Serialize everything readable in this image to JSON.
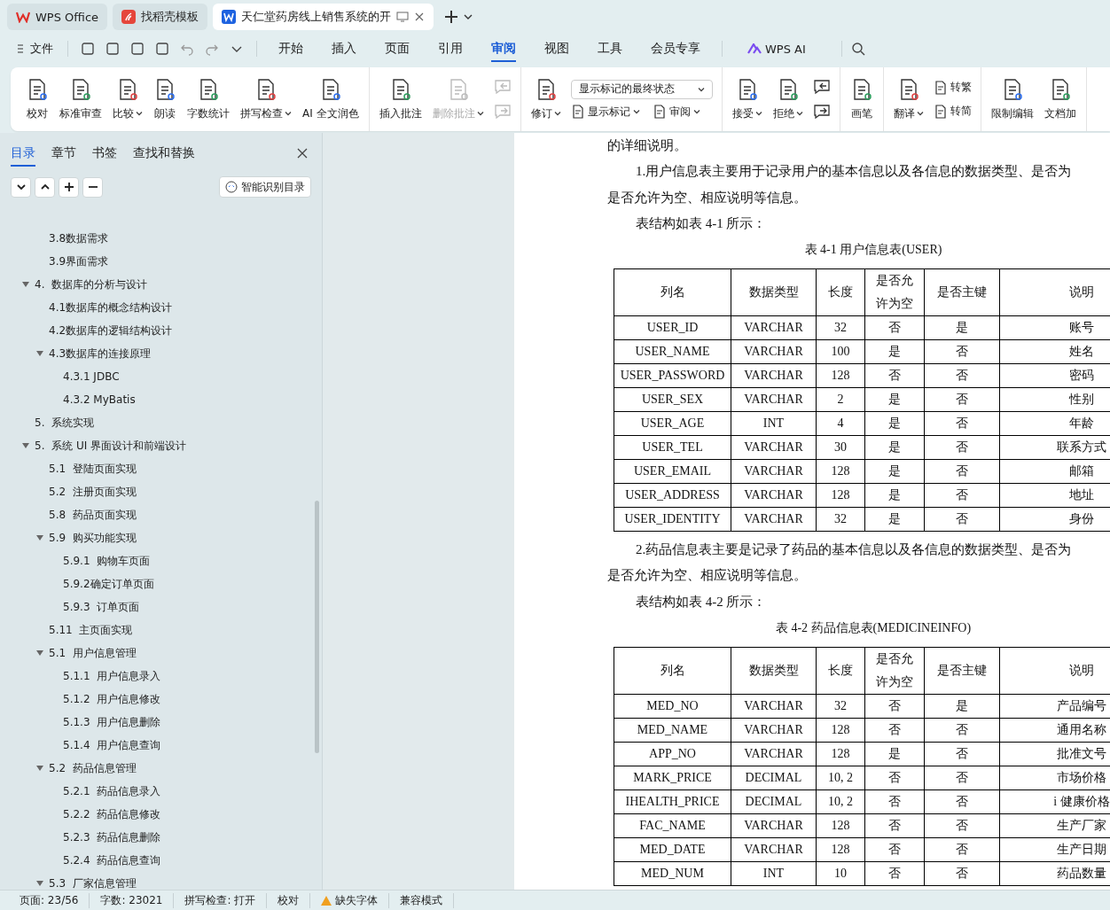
{
  "app_tabs": [
    {
      "label": "WPS Office",
      "kind": "home",
      "selected": false
    },
    {
      "label": "找稻壳模板",
      "kind": "template",
      "selected": false
    },
    {
      "label": "天仁堂药房线上销售系统的开",
      "kind": "document",
      "selected": true
    }
  ],
  "menu": {
    "file": "文件",
    "tabs": [
      {
        "label": "开始",
        "selected": false
      },
      {
        "label": "插入",
        "selected": false
      },
      {
        "label": "页面",
        "selected": false
      },
      {
        "label": "引用",
        "selected": false
      },
      {
        "label": "审阅",
        "selected": true
      },
      {
        "label": "视图",
        "selected": false
      },
      {
        "label": "工具",
        "selected": false
      },
      {
        "label": "会员专享",
        "selected": false
      }
    ],
    "ai": "WPS AI"
  },
  "ribbon": [
    [
      {
        "kind": "large",
        "label": "校对",
        "dropdown": false,
        "disabled": false
      },
      {
        "kind": "large",
        "label": "标准审查",
        "dropdown": false,
        "disabled": false
      },
      {
        "kind": "large",
        "label": "比较",
        "dropdown": true,
        "disabled": false
      },
      {
        "kind": "large",
        "label": "朗读",
        "dropdown": false,
        "disabled": false
      },
      {
        "kind": "large",
        "label": "字数统计",
        "dropdown": false,
        "disabled": false
      },
      {
        "kind": "large",
        "label": "拼写检查",
        "dropdown": true,
        "disabled": false
      },
      {
        "kind": "large",
        "label": "AI 全文润色",
        "dropdown": false,
        "disabled": false
      }
    ],
    [
      {
        "kind": "large",
        "label": "插入批注",
        "dropdown": false,
        "disabled": false
      },
      {
        "kind": "large",
        "label": "删除批注",
        "dropdown": true,
        "disabled": true
      },
      {
        "kind": "icon_pair",
        "disabled": true
      }
    ],
    [
      {
        "kind": "large",
        "label": "修订",
        "dropdown": true,
        "disabled": false
      },
      {
        "kind": "stack",
        "select": "显示标记的最终状态",
        "items": [
          {
            "label": "显示标记",
            "dropdown": true
          },
          {
            "label": "审阅",
            "dropdown": true
          }
        ]
      }
    ],
    [
      {
        "kind": "large",
        "label": "接受",
        "dropdown": true,
        "disabled": false
      },
      {
        "kind": "large",
        "label": "拒绝",
        "dropdown": true,
        "disabled": false
      },
      {
        "kind": "icon_pair",
        "disabled": false
      }
    ],
    [
      {
        "kind": "large",
        "label": "画笔",
        "dropdown": false,
        "disabled": false
      }
    ],
    [
      {
        "kind": "large",
        "label": "翻译",
        "dropdown": true,
        "disabled": false
      },
      {
        "kind": "column",
        "items": [
          {
            "label": "转繁",
            "dropdown": false
          },
          {
            "label": "转简",
            "dropdown": false
          }
        ]
      }
    ],
    [
      {
        "kind": "large",
        "label": "限制编辑",
        "dropdown": false,
        "disabled": false
      },
      {
        "kind": "large",
        "label": "文档加",
        "dropdown": false,
        "disabled": false
      }
    ]
  ],
  "left_panel": {
    "tabs": [
      {
        "label": "目录",
        "selected": true
      },
      {
        "label": "章节",
        "selected": false
      },
      {
        "label": "书签",
        "selected": false
      },
      {
        "label": "查找和替换",
        "selected": false
      }
    ],
    "smart_button": "智能识别目录",
    "toc": [
      {
        "children": [
          {
            "label": "3.8数据需求"
          },
          {
            "label": "3.9界面需求"
          }
        ]
      },
      {
        "label": "4.  数据库的分析与设计",
        "expanded": true,
        "children": [
          {
            "label": "4.1数据库的概念结构设计"
          },
          {
            "label": "4.2数据库的逻辑结构设计"
          },
          {
            "label": "4.3数据库的连接原理",
            "expanded": true,
            "children": [
              {
                "label": "4.3.1 JDBC"
              },
              {
                "label": "4.3.2 MyBatis"
              }
            ]
          }
        ]
      },
      {
        "label": "5.  系统实现"
      },
      {
        "label": "5.  系统 UI 界面设计和前端设计",
        "expanded": true,
        "children": [
          {
            "label": "5.1  登陆页面实现"
          },
          {
            "label": "5.2  注册页面实现"
          },
          {
            "label": "5.8  药品页面实现"
          },
          {
            "label": "5.9  购买功能实现",
            "expanded": true,
            "children": [
              {
                "label": "5.9.1  购物车页面"
              },
              {
                "label": "5.9.2确定订单页面"
              },
              {
                "label": "5.9.3  订单页面"
              }
            ]
          },
          {
            "label": "5.11  主页面实现"
          },
          {
            "label": "5.1  用户信息管理",
            "expanded": true,
            "children": [
              {
                "label": "5.1.1  用户信息录入"
              },
              {
                "label": "5.1.2  用户信息修改"
              },
              {
                "label": "5.1.3  用户信息删除"
              },
              {
                "label": "5.1.4  用户信息查询"
              }
            ]
          },
          {
            "label": "5.2  药品信息管理",
            "expanded": true,
            "children": [
              {
                "label": "5.2.1  药品信息录入"
              },
              {
                "label": "5.2.2  药品信息修改"
              },
              {
                "label": "5.2.3  药品信息删除"
              },
              {
                "label": "5.2.4  药品信息查询"
              }
            ]
          },
          {
            "label": "5.3  厂家信息管理",
            "expanded": true
          }
        ]
      }
    ]
  },
  "document": [
    {
      "kind": "line",
      "text": "的详细说明。"
    },
    {
      "kind": "indented_line",
      "text": "1.用户信息表主要用于记录用户的基本信息以及各信息的数据类型、是否为"
    },
    {
      "kind": "line",
      "text": "是否允许为空、相应说明等信息。"
    },
    {
      "kind": "indented_line",
      "text": "表结构如表 4-1 所示："
    },
    {
      "kind": "caption",
      "text": "表 4-1 用户信息表(USER)"
    },
    {
      "kind": "table",
      "header": [
        "列名",
        "数据类型",
        "长度",
        "是否允许为空",
        "是否主键",
        "说明"
      ],
      "rows": [
        [
          "USER_ID",
          "VARCHAR",
          "32",
          "否",
          "是",
          "账号"
        ],
        [
          "USER_NAME",
          "VARCHAR",
          "100",
          "是",
          "否",
          "姓名"
        ],
        [
          "USER_PASSWORD",
          "VARCHAR",
          "128",
          "否",
          "否",
          "密码"
        ],
        [
          "USER_SEX",
          "VARCHAR",
          "2",
          "是",
          "否",
          "性别"
        ],
        [
          "USER_AGE",
          "INT",
          "4",
          "是",
          "否",
          "年龄"
        ],
        [
          "USER_TEL",
          "VARCHAR",
          "30",
          "是",
          "否",
          "联系方式"
        ],
        [
          "USER_EMAIL",
          "VARCHAR",
          "128",
          "是",
          "否",
          "邮箱"
        ],
        [
          "USER_ADDRESS",
          "VARCHAR",
          "128",
          "是",
          "否",
          "地址"
        ],
        [
          "USER_IDENTITY",
          "VARCHAR",
          "32",
          "是",
          "否",
          "身份"
        ]
      ]
    },
    {
      "kind": "indented_line",
      "text": "2.药品信息表主要是记录了药品的基本信息以及各信息的数据类型、是否为"
    },
    {
      "kind": "line",
      "text": "是否允许为空、相应说明等信息。"
    },
    {
      "kind": "indented_line",
      "text": "表结构如表 4-2 所示："
    },
    {
      "kind": "caption",
      "text": "表 4-2 药品信息表(MEDICINEINFO)"
    },
    {
      "kind": "table",
      "header": [
        "列名",
        "数据类型",
        "长度",
        "是否允许为空",
        "是否主键",
        "说明"
      ],
      "rows": [
        [
          "MED_NO",
          "VARCHAR",
          "32",
          "否",
          "是",
          "产品编号"
        ],
        [
          "MED_NAME",
          "VARCHAR",
          "128",
          "否",
          "否",
          "通用名称"
        ],
        [
          "APP_NO",
          "VARCHAR",
          "128",
          "是",
          "否",
          "批准文号"
        ],
        [
          "MARK_PRICE",
          "DECIMAL",
          "10, 2",
          "否",
          "否",
          "市场价格"
        ],
        [
          "IHEALTH_PRICE",
          "DECIMAL",
          "10, 2",
          "否",
          "否",
          "i 健康价格"
        ],
        [
          "FAC_NAME",
          "VARCHAR",
          "128",
          "否",
          "否",
          "生产厂家"
        ],
        [
          "MED_DATE",
          "VARCHAR",
          "128",
          "否",
          "否",
          "生产日期"
        ],
        [
          "MED_NUM",
          "INT",
          "10",
          "否",
          "否",
          "药品数量"
        ]
      ]
    }
  ],
  "status_bar": [
    {
      "text": "页面: 23/56",
      "warning": false
    },
    {
      "text": "字数: 23021",
      "warning": false
    },
    {
      "text": "拼写检查: 打开",
      "warning": false
    },
    {
      "text": "校对",
      "warning": false
    },
    {
      "text": "缺失字体",
      "warning": true
    },
    {
      "text": "兼容模式",
      "warning": false
    }
  ]
}
